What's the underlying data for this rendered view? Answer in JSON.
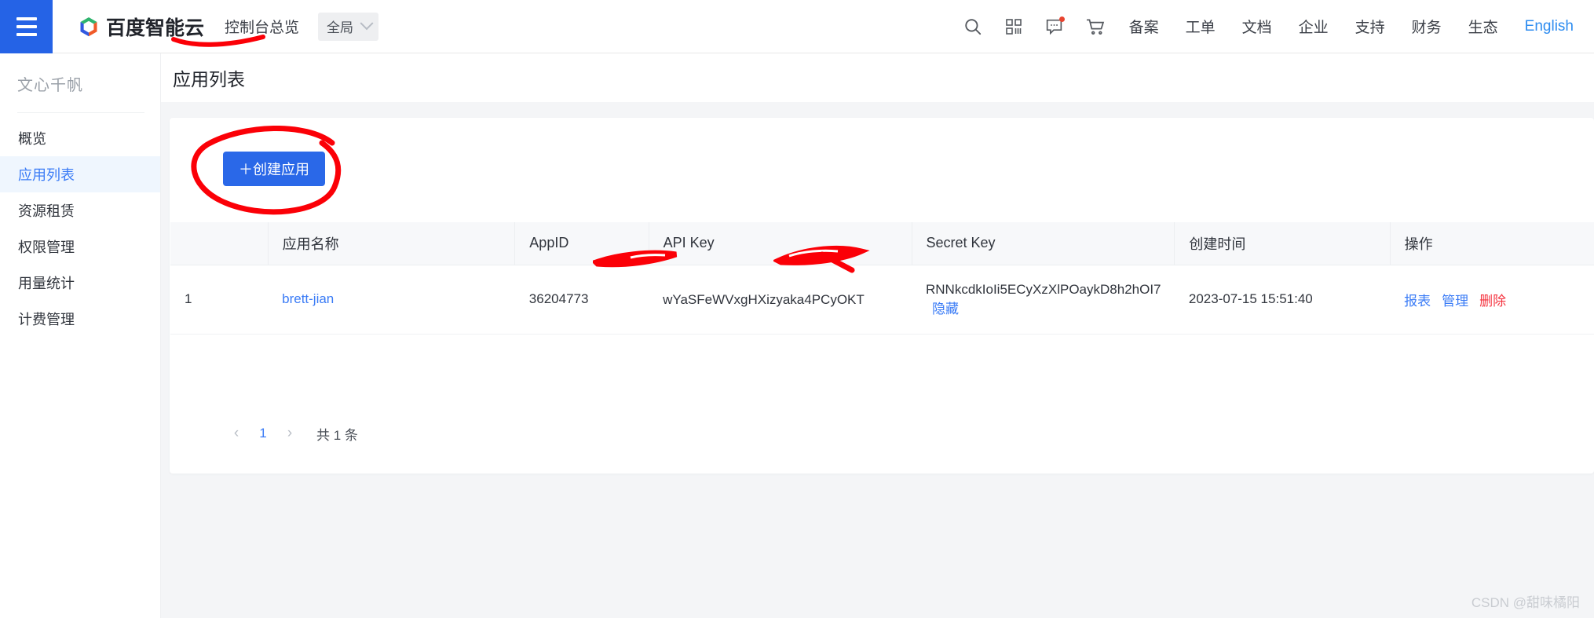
{
  "header": {
    "menu_icon": "hamburger-icon",
    "brand": "百度智能云",
    "console_link": "控制台总览",
    "region": {
      "value": "全局",
      "caret": "chevron-down-icon"
    },
    "icons": [
      {
        "name": "search-icon",
        "glyph": "search"
      },
      {
        "name": "apps-grid-icon",
        "glyph": "grid"
      },
      {
        "name": "message-icon",
        "glyph": "message",
        "badge": true
      },
      {
        "name": "cart-icon",
        "glyph": "cart"
      }
    ],
    "links": [
      "备案",
      "工单",
      "文档",
      "企业",
      "支持",
      "财务",
      "生态"
    ],
    "language_link": "English"
  },
  "sidebar": {
    "title": "文心千帆",
    "items": [
      {
        "label": "概览",
        "active": false
      },
      {
        "label": "应用列表",
        "active": true
      },
      {
        "label": "资源租赁",
        "active": false
      },
      {
        "label": "权限管理",
        "active": false
      },
      {
        "label": "用量统计",
        "active": false
      },
      {
        "label": "计费管理",
        "active": false
      }
    ]
  },
  "main": {
    "page_title": "应用列表",
    "create_button": "＋创建应用",
    "table": {
      "columns": [
        "",
        "应用名称",
        "AppID",
        "API Key",
        "Secret Key",
        "创建时间",
        "操作"
      ],
      "rows": [
        {
          "index": "1",
          "name": "brett-jian",
          "appid": "36204773",
          "api_key": "wYaSFe\u0000\u0000\u0000\u0000\u0000\u0000\u0000zyaka4PCyOKT",
          "api_key_display": "wYaSFeWVxgHXizyaka4PCyOKT",
          "secret_key_display": "RNNkcdkIoIi5ECyXzXlPOaykD8h2hOI7",
          "secret_hide_link": "隐藏",
          "created": "2023-07-15 15:51:40",
          "ops": [
            {
              "label": "报表",
              "danger": false
            },
            {
              "label": "管理",
              "danger": false
            },
            {
              "label": "删除",
              "danger": true
            }
          ]
        }
      ]
    },
    "pagination": {
      "prev": "‹",
      "pages": [
        "1"
      ],
      "next": "›",
      "total": "共 1 条"
    }
  },
  "watermark": "CSDN @甜味橘阳",
  "colors": {
    "accent_blue": "#2a68e8",
    "link_blue": "#3b7cf6",
    "danger_red": "#f5333f",
    "annotation_red": "#fb0007",
    "sidebar_active_bg": "#eff6fe",
    "page_bg": "#f4f5f7"
  }
}
